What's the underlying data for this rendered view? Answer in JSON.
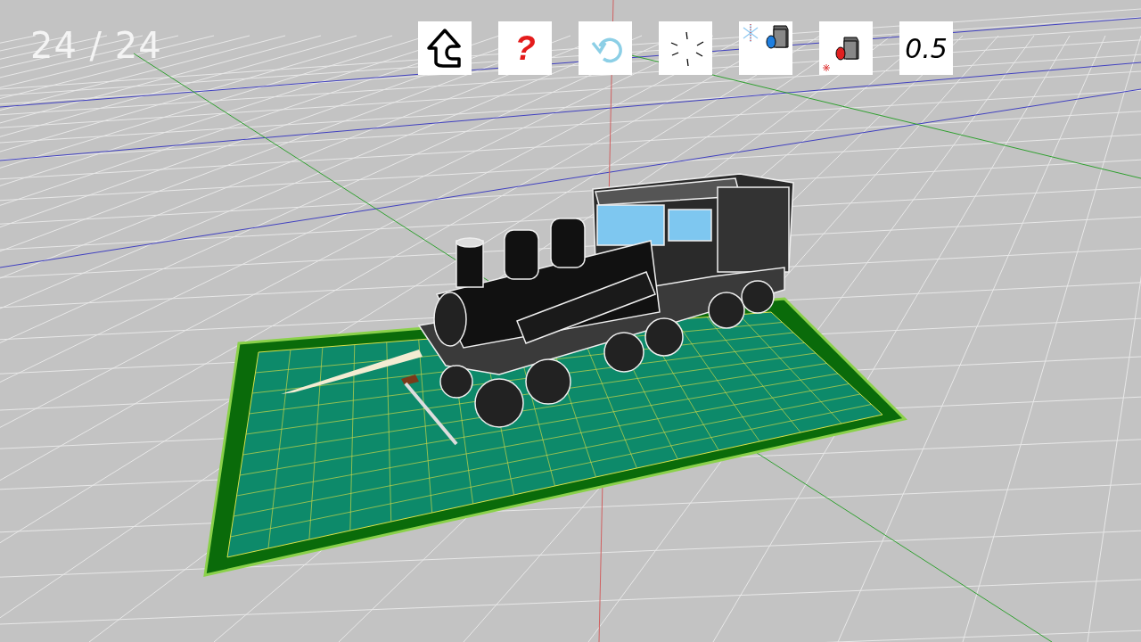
{
  "counter": "24 / 24",
  "toolbar": [
    {
      "kind": "up"
    },
    {
      "kind": "help",
      "label": "?"
    },
    {
      "kind": "undo"
    },
    {
      "kind": "burst"
    },
    {
      "kind": "snow-camera"
    },
    {
      "kind": "fire-camera"
    },
    {
      "kind": "value",
      "label": "0.5"
    }
  ]
}
